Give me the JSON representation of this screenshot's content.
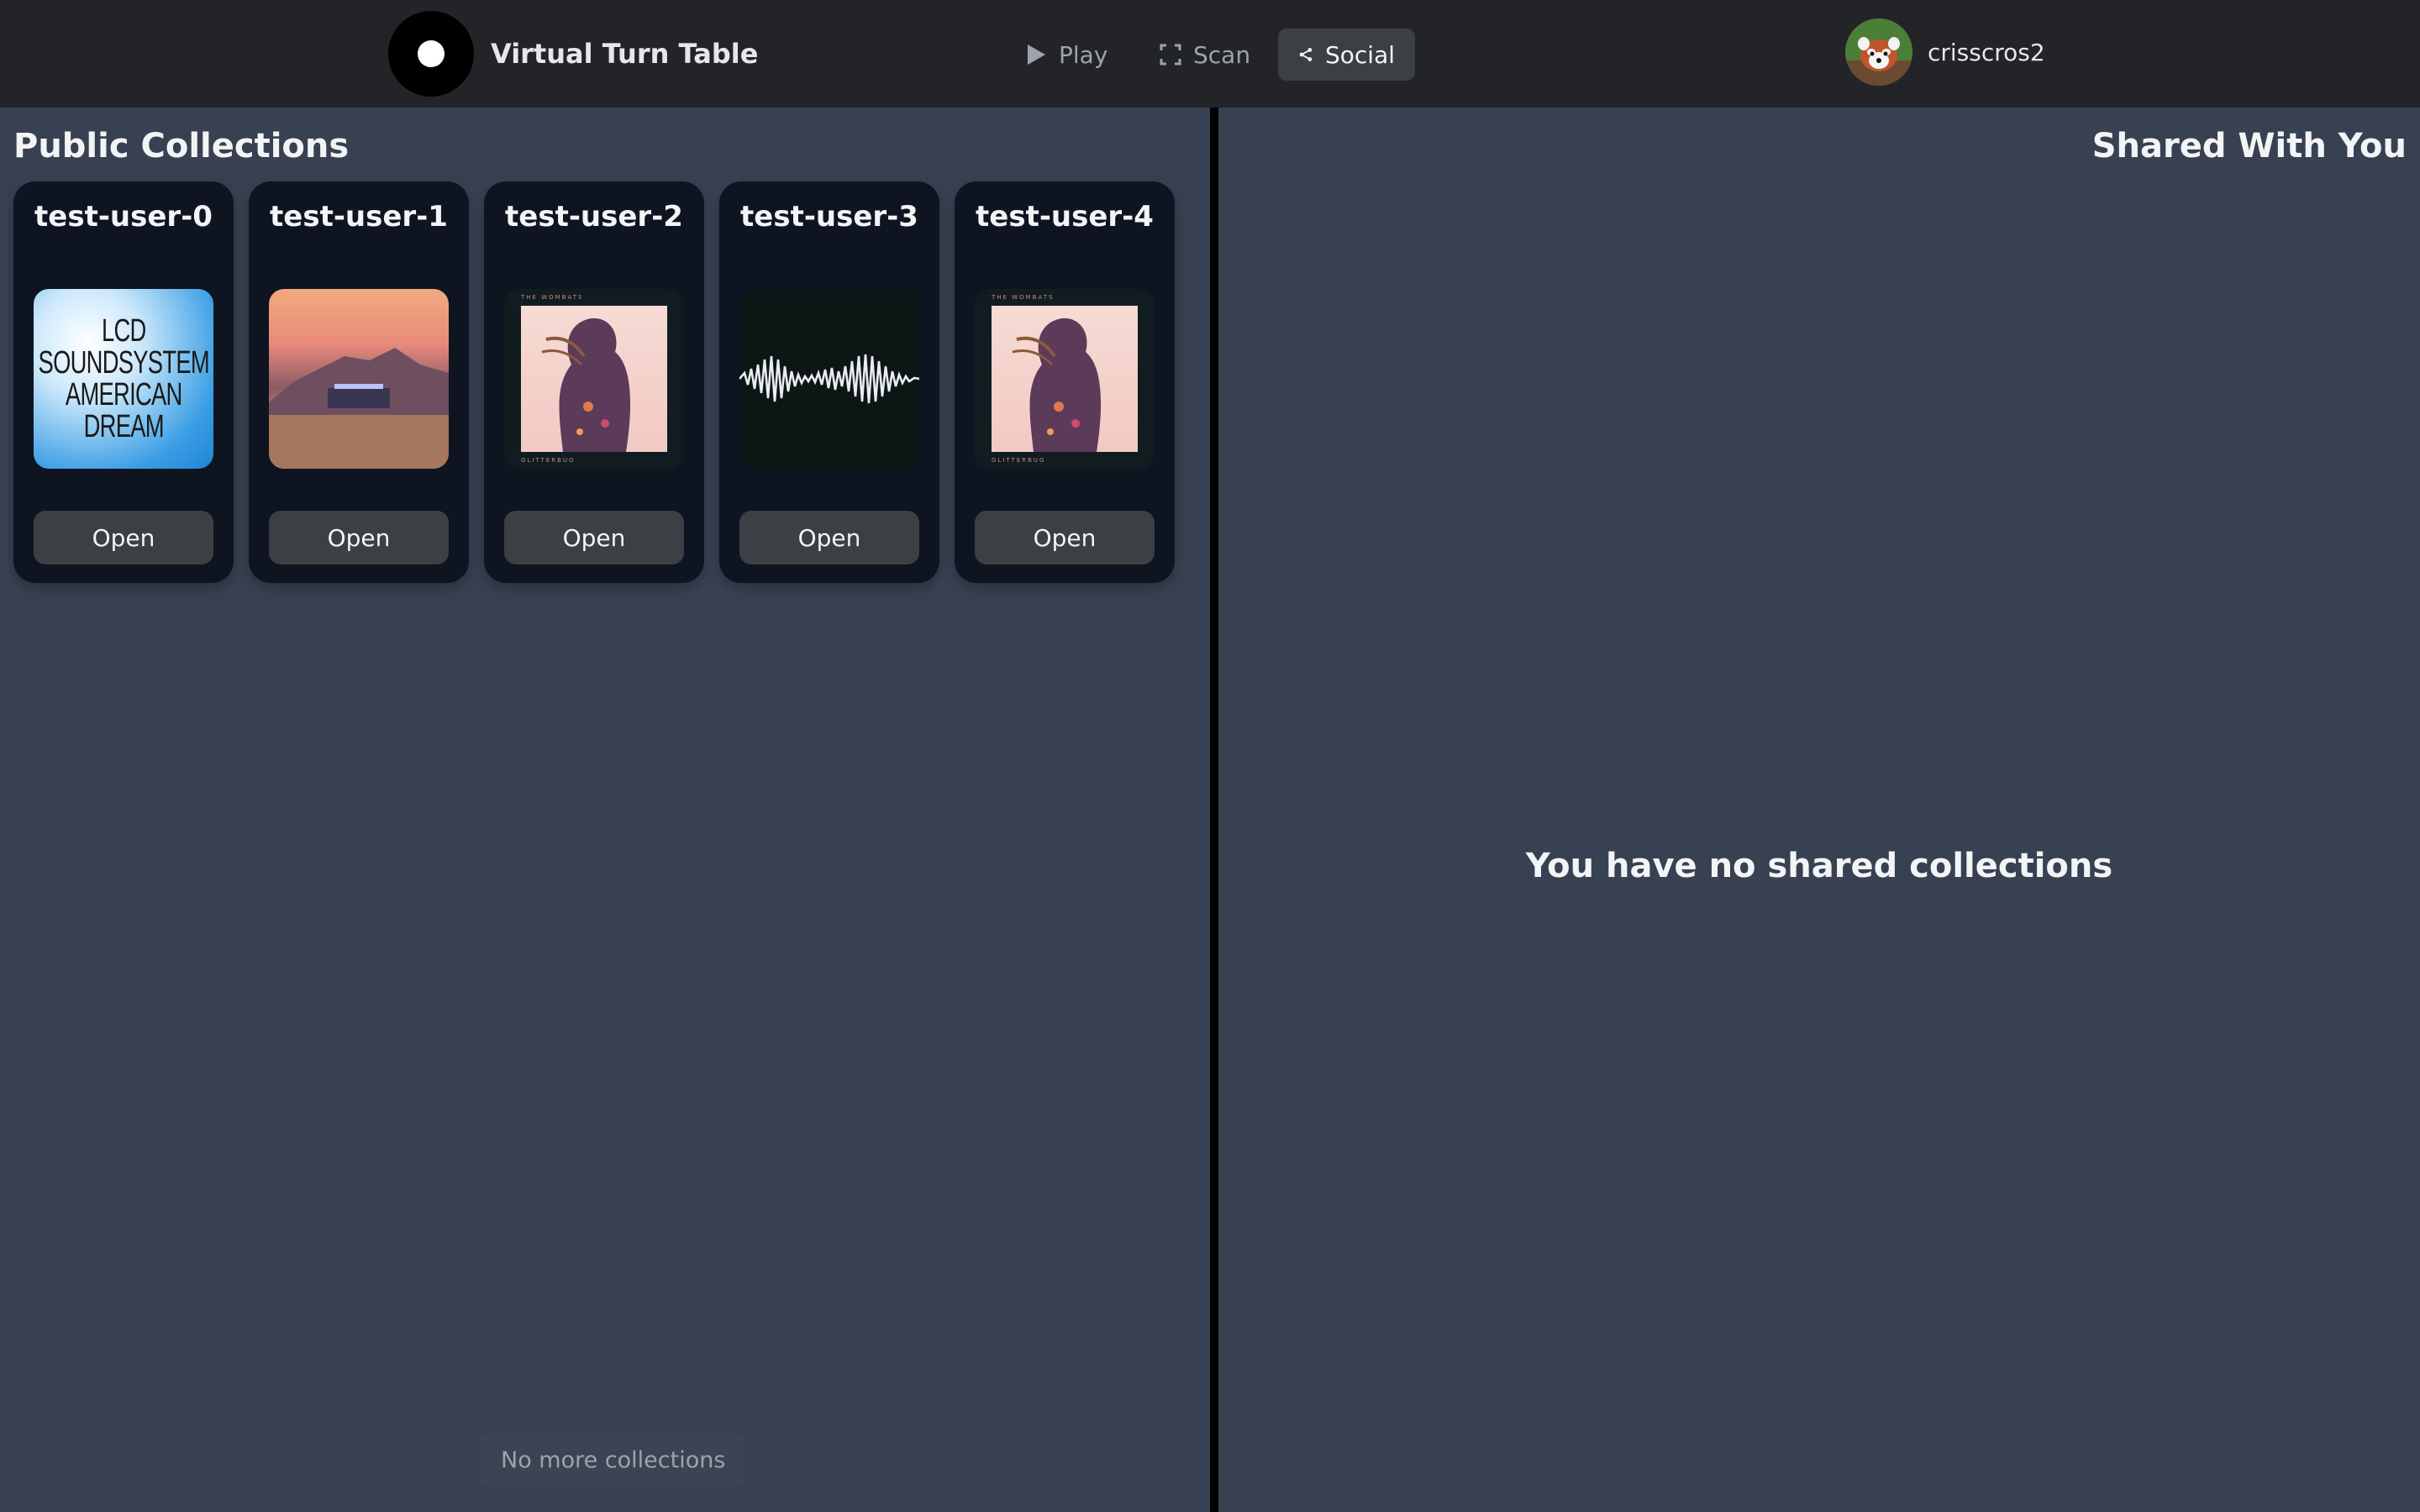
{
  "app": {
    "title": "Virtual Turn Table"
  },
  "nav": {
    "items": [
      {
        "label": "Play",
        "icon": "play-icon",
        "active": false
      },
      {
        "label": "Scan",
        "icon": "scan-icon",
        "active": false
      },
      {
        "label": "Social",
        "icon": "share-icon",
        "active": true
      }
    ]
  },
  "user": {
    "name": "crisscros2",
    "avatar": "red-panda-avatar"
  },
  "public_collections": {
    "heading": "Public Collections",
    "cards": [
      {
        "user": "test-user-0",
        "cover": "lcd-soundsystem-american-dream",
        "cover_text": "LCD\nSOUNDSYSTEM\nAMERICAN\nDREAM",
        "button": "Open"
      },
      {
        "user": "test-user-1",
        "cover": "desert-sign-album",
        "button": "Open"
      },
      {
        "user": "test-user-2",
        "cover": "the-wombats-glitterbug",
        "cover_top_text": "THE WOMBATS",
        "cover_bottom_text": "GLITTERBUG",
        "button": "Open"
      },
      {
        "user": "test-user-3",
        "cover": "soundwave-album",
        "button": "Open"
      },
      {
        "user": "test-user-4",
        "cover": "the-wombats-glitterbug",
        "cover_top_text": "THE WOMBATS",
        "cover_bottom_text": "GLITTERBUG",
        "button": "Open"
      }
    ],
    "footer": "No more collections"
  },
  "shared": {
    "heading": "Shared With You",
    "empty_message": "You have no shared collections"
  },
  "colors": {
    "navbar": "#232427",
    "page": "#384152",
    "card": "#0e1521",
    "button": "#3c3f44",
    "divider": "#000000"
  }
}
